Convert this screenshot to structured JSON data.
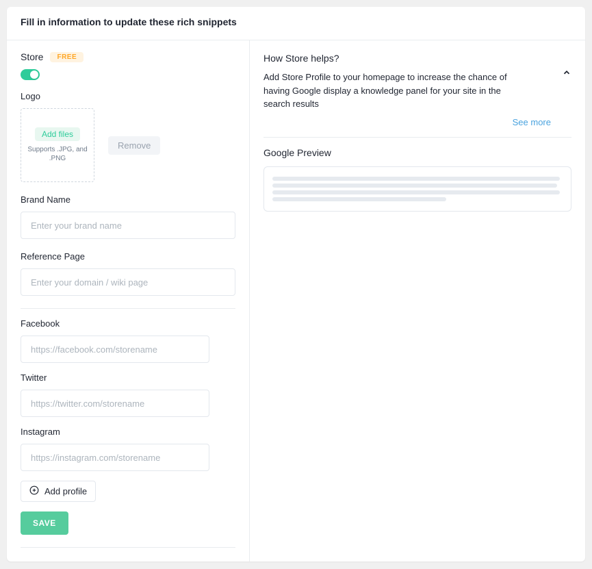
{
  "header": {
    "title": "Fill in information to update these rich snippets"
  },
  "left": {
    "section_title": "Store",
    "badge": "FREE",
    "logo": {
      "label": "Logo",
      "add_files": "Add files",
      "hint": "Supports .JPG, and .PNG",
      "remove": "Remove"
    },
    "brand": {
      "label": "Brand Name",
      "placeholder": "Enter your brand name",
      "value": ""
    },
    "reference": {
      "label": "Reference Page",
      "placeholder": "Enter your domain / wiki page",
      "value": ""
    },
    "socials": {
      "facebook": {
        "label": "Facebook",
        "placeholder": "https://facebook.com/storename",
        "value": ""
      },
      "twitter": {
        "label": "Twitter",
        "placeholder": "https://twitter.com/storename",
        "value": ""
      },
      "instagram": {
        "label": "Instagram",
        "placeholder": "https://instagram.com/storename",
        "value": ""
      }
    },
    "add_profile": "Add profile",
    "save": "SAVE"
  },
  "right": {
    "help": {
      "title": "How Store helps?",
      "body": "Add Store Profile to your homepage to increase the chance of having Google display a knowledge panel for your site in the search results",
      "see_more": "See more"
    },
    "preview": {
      "title": "Google Preview"
    }
  }
}
